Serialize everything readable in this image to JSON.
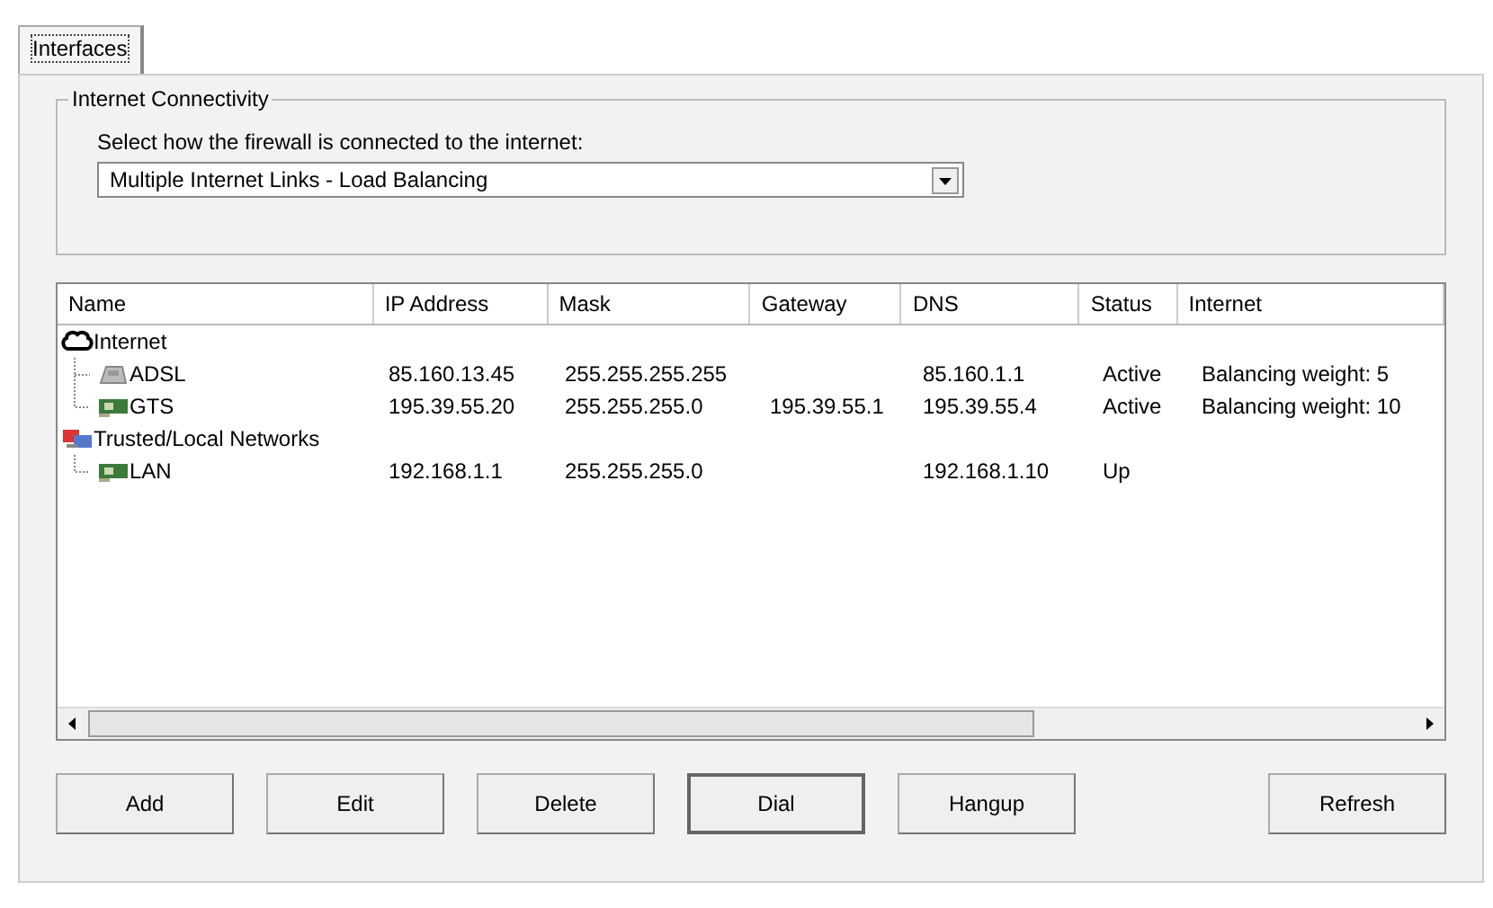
{
  "tabs": [
    {
      "label": "Interfaces",
      "selected": true
    }
  ],
  "connectivity": {
    "title": "Internet Connectivity",
    "prompt": "Select how the firewall is connected to the internet:",
    "value": "Multiple Internet Links - Load Balancing"
  },
  "table": {
    "columns": [
      "Name",
      "IP Address",
      "Mask",
      "Gateway",
      "DNS",
      "Status",
      "Internet"
    ],
    "groups": [
      {
        "name": "Internet",
        "kind": "cloud",
        "children": [
          {
            "kind": "modem",
            "cells": [
              "ADSL",
              "85.160.13.45",
              "255.255.255.255",
              "",
              "85.160.1.1",
              "Active",
              "Balancing weight: 5"
            ]
          },
          {
            "kind": "card",
            "cells": [
              "GTS",
              "195.39.55.20",
              "255.255.255.0",
              "195.39.55.1",
              "195.39.55.4",
              "Active",
              "Balancing weight: 10"
            ]
          }
        ]
      },
      {
        "name": "Trusted/Local Networks",
        "kind": "network",
        "children": [
          {
            "kind": "card",
            "cells": [
              "LAN",
              "192.168.1.1",
              "255.255.255.0",
              "",
              "192.168.1.10",
              "Up",
              ""
            ]
          }
        ]
      }
    ]
  },
  "buttons": [
    {
      "label": "Add",
      "default": false
    },
    {
      "label": "Edit",
      "default": false
    },
    {
      "label": "Delete",
      "default": false
    },
    {
      "label": "Dial",
      "default": true
    },
    {
      "label": "Hangup",
      "default": false
    },
    {
      "label": "Refresh",
      "default": false
    }
  ]
}
